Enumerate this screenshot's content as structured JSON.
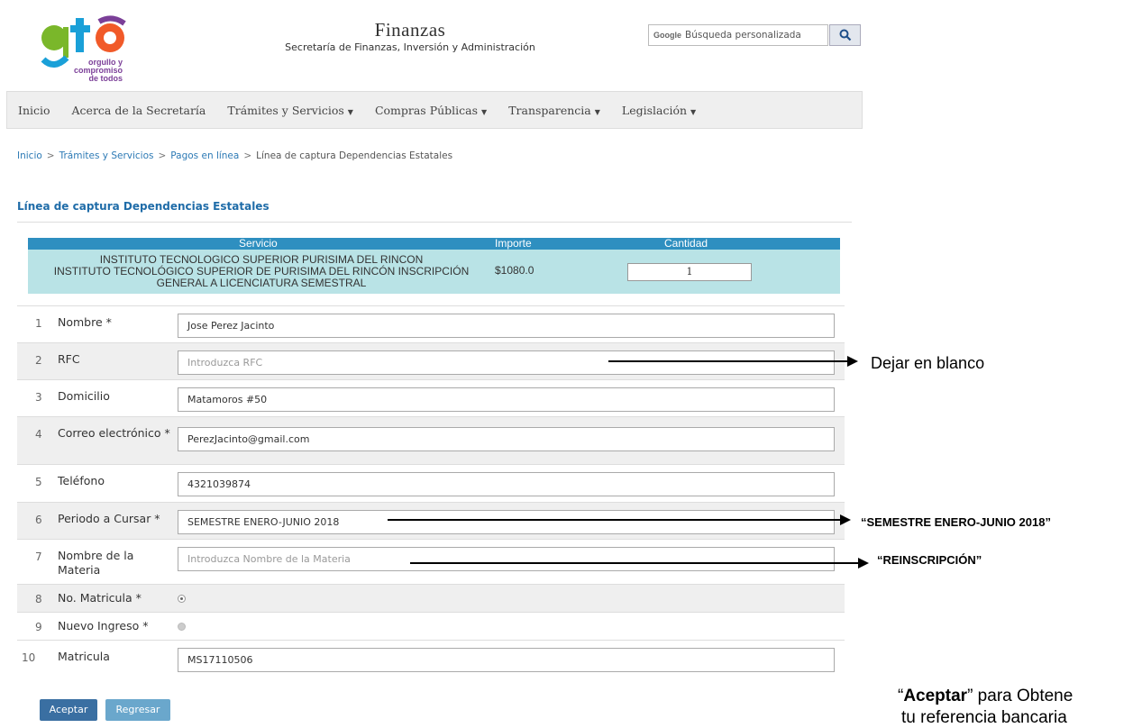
{
  "header": {
    "logo_text": "gto",
    "logo_tagline": [
      "orgullo y",
      "compromiso",
      "de todos"
    ],
    "title": "Finanzas",
    "subtitle": "Secretaría de Finanzas, Inversión y Administración",
    "search_brand": "Google",
    "search_placeholder": "Búsqueda personalizada"
  },
  "nav": [
    {
      "label": "Inicio",
      "dropdown": false
    },
    {
      "label": "Acerca de la Secretaría",
      "dropdown": false
    },
    {
      "label": "Trámites y Servicios",
      "dropdown": true
    },
    {
      "label": "Compras Públicas",
      "dropdown": true
    },
    {
      "label": "Transparencia",
      "dropdown": true
    },
    {
      "label": "Legislación",
      "dropdown": true
    }
  ],
  "breadcrumb": {
    "items": [
      "Inicio",
      "Trámites y Servicios",
      "Pagos en línea",
      "Línea de captura Dependencias Estatales"
    ],
    "separator": ">"
  },
  "page_title": "Línea de captura Dependencias Estatales",
  "service": {
    "headers": {
      "servicio": "Servicio",
      "importe": "Importe",
      "cantidad": "Cantidad"
    },
    "description_lines": [
      "INSTITUTO TECNOLOGICO SUPERIOR PURISIMA DEL RINCON",
      "INSTITUTO TECNOLÓGICO SUPERIOR DE PURISIMA DEL RINCÓN INSCRIPCIÓN",
      "GENERAL A LICENCIATURA SEMESTRAL"
    ],
    "importe": "$1080.0",
    "cantidad": "1"
  },
  "form": {
    "rows": [
      {
        "num": "1",
        "label": "Nombre *",
        "value": "Jose Perez Jacinto",
        "placeholder": ""
      },
      {
        "num": "2",
        "label": "RFC",
        "value": "",
        "placeholder": "Introduzca RFC"
      },
      {
        "num": "3",
        "label": "Domicilio",
        "value": "Matamoros #50",
        "placeholder": ""
      },
      {
        "num": "4",
        "label": "Correo electrónico *",
        "value": "PerezJacinto@gmail.com",
        "placeholder": ""
      },
      {
        "num": "5",
        "label": "Teléfono",
        "value": "4321039874",
        "placeholder": ""
      },
      {
        "num": "6",
        "label": "Periodo a Cursar *",
        "value": "SEMESTRE ENERO-JUNIO 2018",
        "placeholder": ""
      },
      {
        "num": "7",
        "label": "Nombre de la Materia",
        "value": "",
        "placeholder": "Introduzca Nombre de la Materia"
      },
      {
        "num": "8",
        "label": "No. Matricula *",
        "radio": "selected"
      },
      {
        "num": "9",
        "label": "Nuevo Ingreso *",
        "radio": "unselected"
      },
      {
        "num": "10",
        "label": "Matricula",
        "value": "MS17110506",
        "placeholder": ""
      }
    ]
  },
  "buttons": {
    "accept": "Aceptar",
    "back": "Regresar"
  },
  "annotations": {
    "note_rfc": "Dejar en blanco",
    "note_periodo": "“SEMESTRE ENERO-JUNIO 2018”",
    "note_materia": "“REINSCRIPCIÓN”",
    "note_aceptar_open": "“",
    "note_aceptar_bold": "Aceptar",
    "note_aceptar_rest": "” para Obtene",
    "note_aceptar_line2": "tu referencia bancaria"
  },
  "colors": {
    "logo_green": "#7ab72a",
    "logo_blue": "#1aa0d8",
    "logo_orange": "#f15a29",
    "logo_purple": "#7b3f98",
    "header_teal": "#2e8fc0",
    "service_bg": "#b9e3e6",
    "link_blue": "#2d7ab5"
  }
}
